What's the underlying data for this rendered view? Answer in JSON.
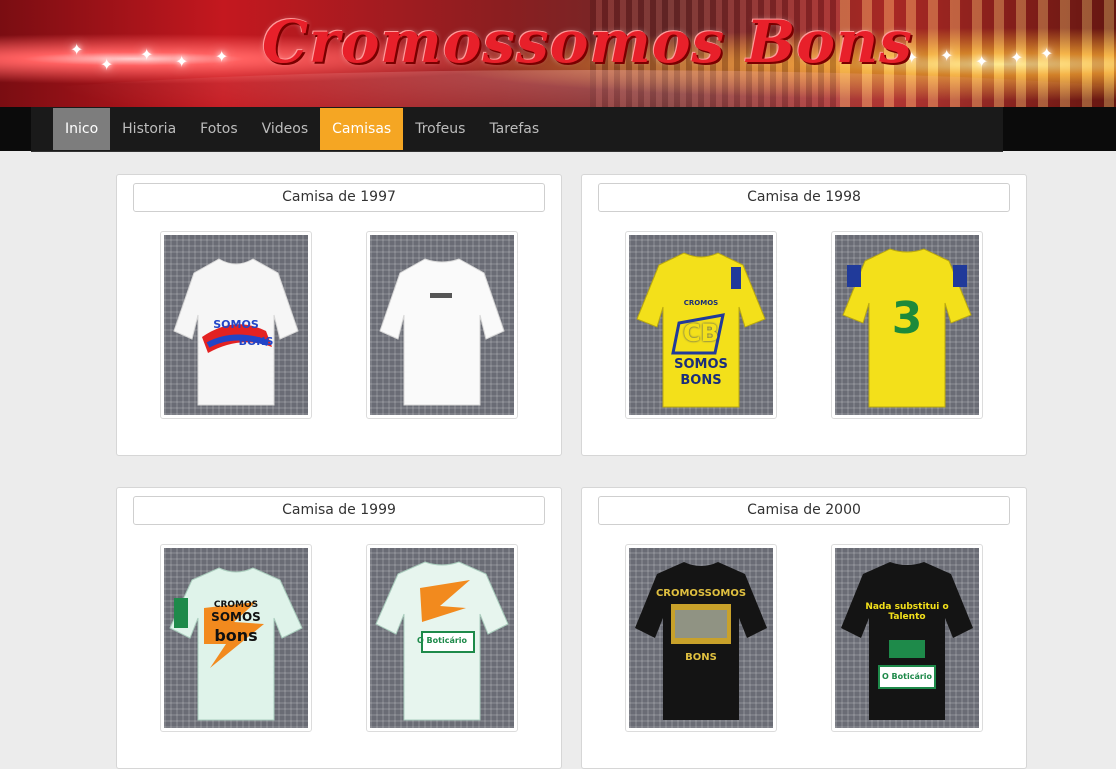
{
  "banner": {
    "title": "Cromossomos Bons"
  },
  "nav": {
    "items": [
      {
        "label": "Inico"
      },
      {
        "label": "Historia"
      },
      {
        "label": "Fotos"
      },
      {
        "label": "Videos"
      },
      {
        "label": "Camisas"
      },
      {
        "label": "Trofeus"
      },
      {
        "label": "Tarefas"
      }
    ],
    "active_item": "Inico",
    "current_page": "Camisas"
  },
  "colors": {
    "nav_bg": "#1a1a1a",
    "nav_active": "#7d7d7d",
    "nav_current": "#f5a623",
    "page_bg": "#ececec"
  },
  "shirts": [
    {
      "title": "Camisa de 1997",
      "front": {
        "color": "#f6f6f6",
        "lines": [
          "SOMOS",
          "BONS"
        ]
      },
      "back": {
        "color": "#fafafa",
        "lines": []
      }
    },
    {
      "title": "Camisa de 1998",
      "front": {
        "color": "#f3e01a",
        "lines": [
          "CROMOS",
          "CB",
          "SOMOS",
          "BONS"
        ]
      },
      "back": {
        "color": "#f3e01a",
        "lines": [
          "3"
        ]
      }
    },
    {
      "title": "Camisa de 1999",
      "front": {
        "color": "#dff3ea",
        "lines": [
          "CROMOS",
          "SOMOS",
          "bons"
        ]
      },
      "back": {
        "color": "#e7f5ee",
        "lines": [
          "O Boticário"
        ]
      }
    },
    {
      "title": "Camisa de 2000",
      "front": {
        "color": "#141414",
        "lines": [
          "CROMOSSOMOS",
          "BONS"
        ]
      },
      "back": {
        "color": "#141414",
        "lines": [
          "Nada substitui o Talento",
          "O Boticário"
        ]
      }
    }
  ]
}
